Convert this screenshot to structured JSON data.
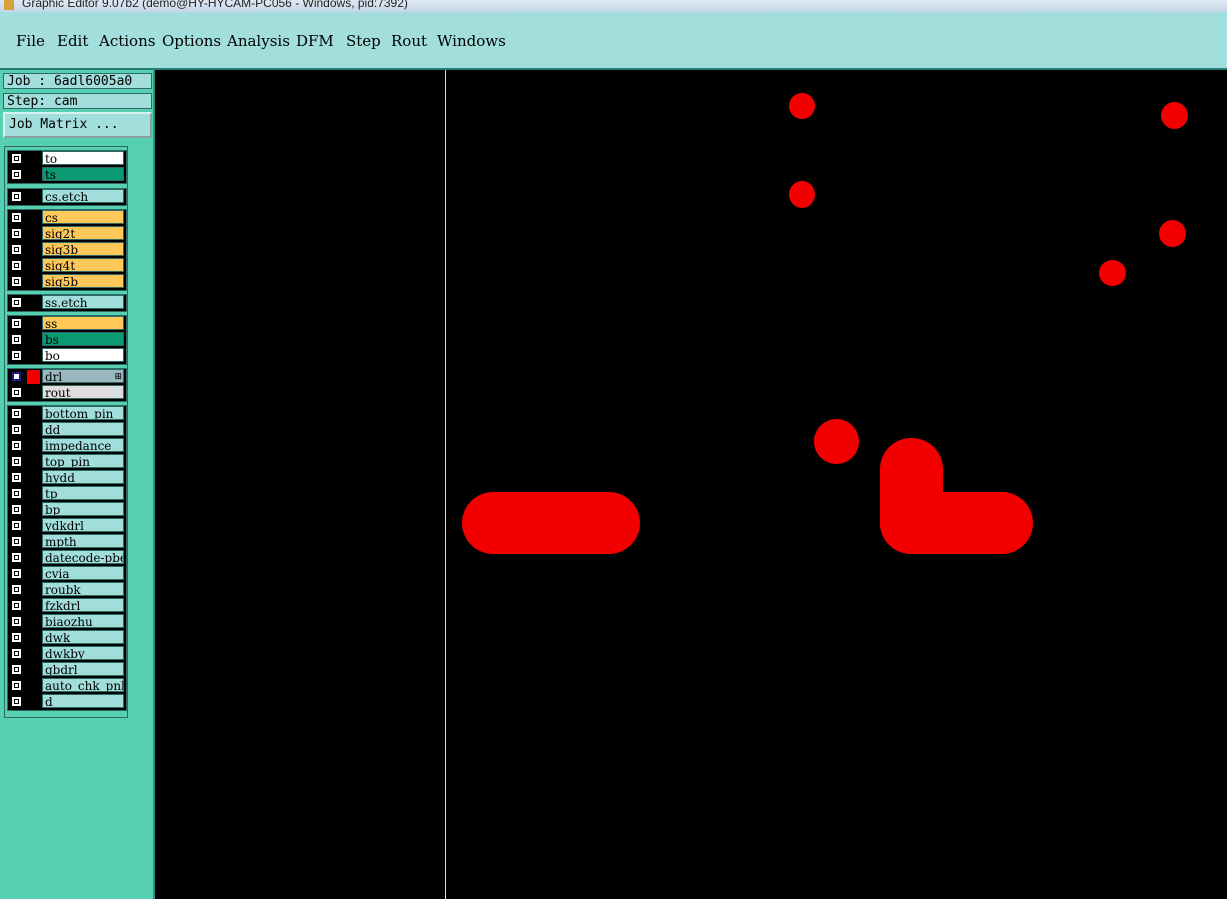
{
  "window": {
    "title": "Graphic Editor 9.07b2 (demo@HY-HYCAM-PC056 - Windows, pid:7392)"
  },
  "menu": [
    "File",
    "Edit",
    "Actions",
    "Options",
    "Analysis",
    "DFM",
    "Step",
    "Rout",
    "Windows"
  ],
  "job": {
    "label": "Job : 6adl6005a0",
    "step": "Step: cam",
    "matrix_button": "Job Matrix ..."
  },
  "layers": [
    {
      "name": "to",
      "color": "#ffffff"
    },
    {
      "name": "ts",
      "color": "#0a9a72"
    },
    {
      "name": "cs.etch",
      "color": "#a2dedc"
    },
    {
      "name": "cs",
      "color": "#ffc95a"
    },
    {
      "name": "sig2t",
      "color": "#ffc95a"
    },
    {
      "name": "sig3b",
      "color": "#ffc95a"
    },
    {
      "name": "sig4t",
      "color": "#ffc95a"
    },
    {
      "name": "sig5b",
      "color": "#ffc95a"
    },
    {
      "name": "ss.etch",
      "color": "#a2dedc"
    },
    {
      "name": "ss",
      "color": "#ffc95a"
    },
    {
      "name": "bs",
      "color": "#0a9a72"
    },
    {
      "name": "bo",
      "color": "#ffffff"
    },
    {
      "name": "drl",
      "color": "#9ab8bf",
      "active": true,
      "swatch": "#f20000"
    },
    {
      "name": "rout",
      "color": "#dedede"
    },
    {
      "name": "bottom_pin",
      "color": "#a2dedc"
    },
    {
      "name": "dd",
      "color": "#a2dedc"
    },
    {
      "name": "impedance",
      "color": "#a2dedc"
    },
    {
      "name": "top_pin",
      "color": "#a2dedc"
    },
    {
      "name": "hydd",
      "color": "#a2dedc"
    },
    {
      "name": "tp",
      "color": "#a2dedc"
    },
    {
      "name": "bp",
      "color": "#a2dedc"
    },
    {
      "name": "ydkdrl",
      "color": "#a2dedc"
    },
    {
      "name": "mpth",
      "color": "#a2dedc"
    },
    {
      "name": "datecode-pbe",
      "color": "#a2dedc"
    },
    {
      "name": "cvia",
      "color": "#a2dedc"
    },
    {
      "name": "roubk",
      "color": "#a2dedc"
    },
    {
      "name": "fzkdrl",
      "color": "#a2dedc"
    },
    {
      "name": "biaozhu",
      "color": "#a2dedc"
    },
    {
      "name": "dwk",
      "color": "#a2dedc"
    },
    {
      "name": "dwkby",
      "color": "#a2dedc"
    },
    {
      "name": "gbdrl",
      "color": "#a2dedc"
    },
    {
      "name": "auto_chk_pnl",
      "color": "#a2dedc"
    },
    {
      "name": "d",
      "color": "#a2dedc"
    }
  ],
  "colors": {
    "feature": "#f20000",
    "menubar": "#a2dedc",
    "panel": "#57cfb1"
  }
}
